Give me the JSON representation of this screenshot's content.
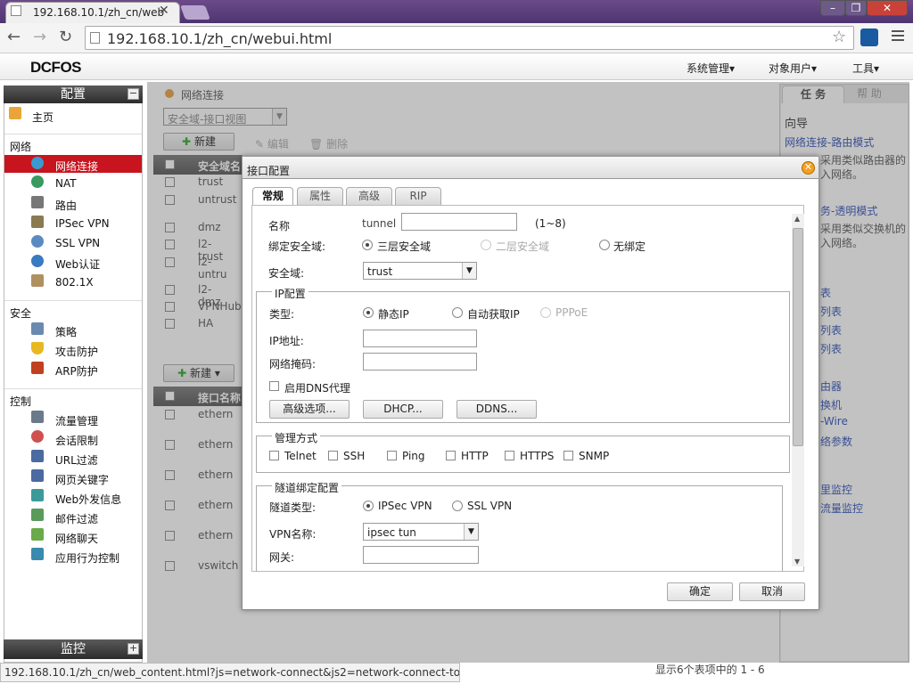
{
  "browser": {
    "tab_title": "192.168.10.1/zh_cn/web",
    "url": "192.168.10.1/zh_cn/webui.html",
    "status_url": "192.168.10.1/zh_cn/web_content.html?js=network-connect&js2=network-connect-tools#"
  },
  "app": {
    "logo": "DCFOS",
    "menu": [
      "系统管理▾",
      "对象用户▾",
      "工具▾"
    ]
  },
  "sidebar": {
    "header": "配置",
    "toggle": "−",
    "home": "主页",
    "sections": [
      {
        "title": "网络",
        "items": [
          "网络连接",
          "NAT",
          "路由",
          "IPSec VPN",
          "SSL VPN",
          "Web认证",
          "802.1X"
        ]
      },
      {
        "title": "安全",
        "items": [
          "策略",
          "攻击防护",
          "ARP防护"
        ]
      },
      {
        "title": "控制",
        "items": [
          "流量管理",
          "会话限制",
          "URL过滤",
          "网页关键字",
          "Web外发信息",
          "邮件过滤",
          "网络聊天",
          "应用行为控制"
        ]
      }
    ],
    "footer": "监控",
    "footer_toggle": "+"
  },
  "main": {
    "breadcrumb": "网络连接",
    "view_select": "安全域-接口视图",
    "new_button": "新建",
    "edit_button": "编辑",
    "delete_button": "删除",
    "zone_table_header": "安全域名",
    "zones": [
      "trust",
      "untrust",
      "dmz",
      "l2-trust",
      "l2-untru",
      "l2-dmz",
      "VPNHub",
      "HA"
    ],
    "new_button2": "新建",
    "iface_table_header": "接口名称",
    "interfaces": [
      "ethern",
      "ethern",
      "ethern",
      "ethern",
      "ethern",
      "vswitch"
    ],
    "pager_text": "显示6个表项中的 1 - 6"
  },
  "right_panel": {
    "tab_task": "任 务",
    "tab_help": "帮 助",
    "guide_title": "向导",
    "link_route_mode": "网络连接-路由模式",
    "route_desc": "采用类似路由器的入网络。",
    "link_transparent": "务-透明模式",
    "transparent_desc": "采用类似交换机的入网络。",
    "links": [
      "表",
      "列表",
      "列表",
      "列表",
      "由器",
      "换机",
      "-Wire",
      "络参数",
      "里监控",
      "流量监控"
    ]
  },
  "dialog": {
    "title": "接口配置",
    "tabs": [
      "常规",
      "属性",
      "高级",
      "RIP"
    ],
    "name_label": "名称",
    "name_prefix": "tunnel",
    "name_hint": "(1~8)",
    "bind_label": "绑定安全域:",
    "bind_options": [
      "三层安全域",
      "二层安全域",
      "无绑定"
    ],
    "zone_label": "安全域:",
    "zone_value": "trust",
    "ip_legend": "IP配置",
    "type_label": "类型:",
    "type_options": [
      "静态IP",
      "自动获取IP",
      "PPPoE"
    ],
    "ip_label": "IP地址:",
    "mask_label": "网络掩码:",
    "dns_proxy_label": "启用DNS代理",
    "btn_advanced": "高级选项...",
    "btn_dhcp": "DHCP...",
    "btn_ddns": "DDNS...",
    "mgmt_legend": "管理方式",
    "mgmt_options": [
      "Telnet",
      "SSH",
      "Ping",
      "HTTP",
      "HTTPS",
      "SNMP"
    ],
    "tunnel_legend": "隧道绑定配置",
    "tunnel_type_label": "隧道类型:",
    "tunnel_type_options": [
      "IPSec VPN",
      "SSL VPN"
    ],
    "vpn_name_label": "VPN名称:",
    "vpn_name_value": "ipsec tun",
    "gateway_label": "网关:",
    "ok_button": "确定",
    "cancel_button": "取消"
  }
}
